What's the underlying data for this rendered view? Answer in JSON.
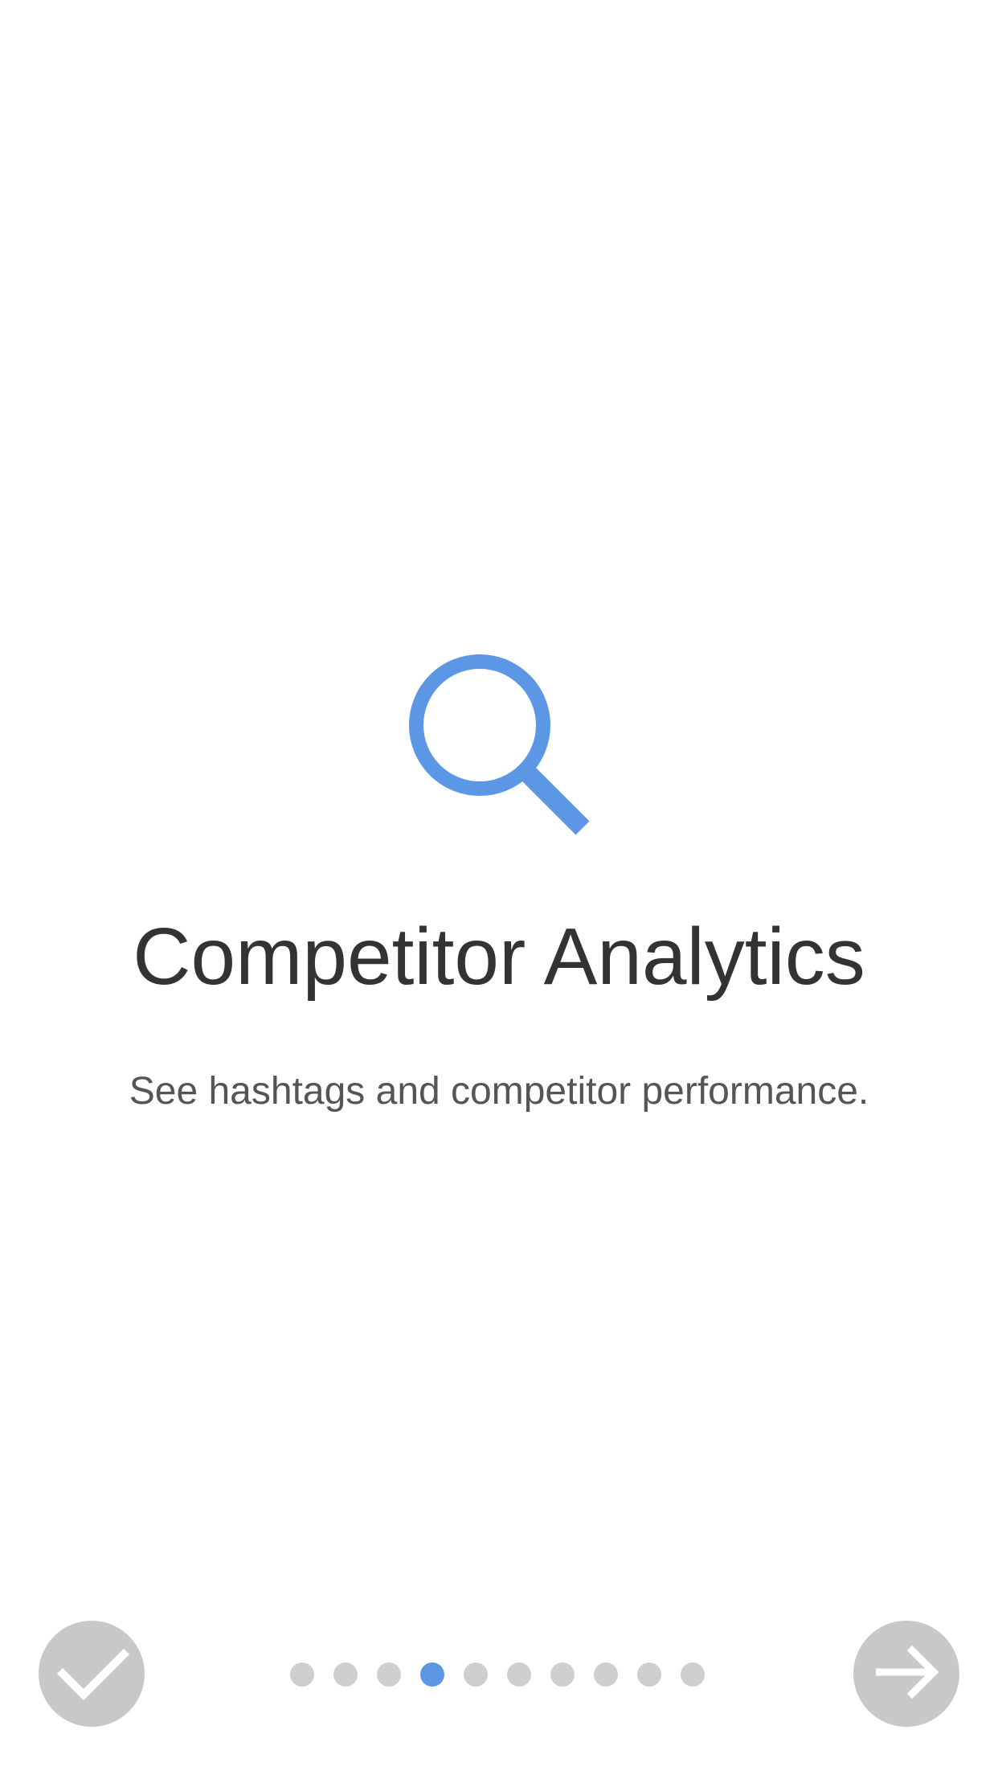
{
  "colors": {
    "accent": "#5b97e5",
    "title_text": "#333333",
    "subtitle_text": "#555555",
    "button_bg": "#c8c8c8",
    "dot_inactive": "#cfcfcf",
    "background": "#ffffff"
  },
  "onboarding": {
    "icon": "search-icon",
    "title": "Competitor Analytics",
    "subtitle": "See hashtags and competitor performance."
  },
  "pagination": {
    "total_pages": 10,
    "current_page": 4
  },
  "controls": {
    "done_icon": "checkmark-icon",
    "next_icon": "arrow-right-icon"
  }
}
